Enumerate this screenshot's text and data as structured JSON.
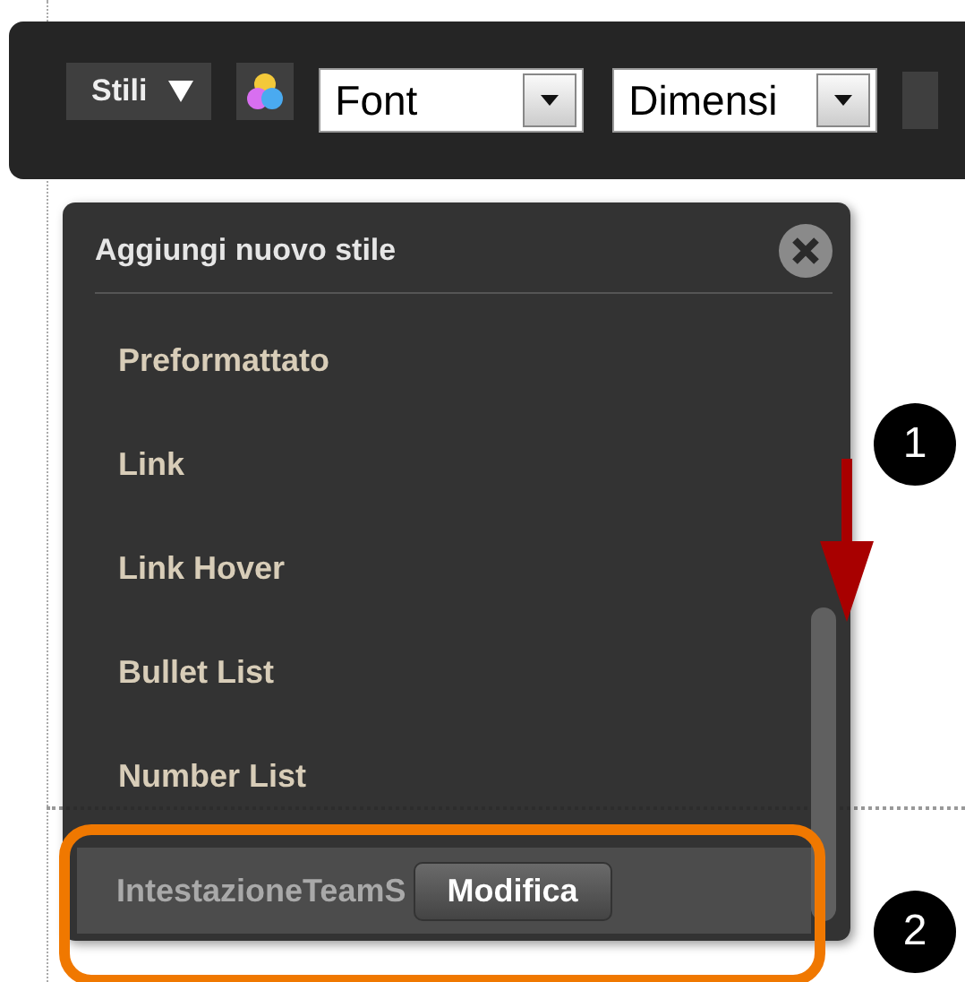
{
  "toolbar": {
    "styles_button": "Stili",
    "font_select": {
      "value": "Font"
    },
    "size_select": {
      "value": "Dimensi"
    }
  },
  "styles_popup": {
    "title": "Aggiungi nuovo stile",
    "items": [
      {
        "label": "Preformattato",
        "selected": false
      },
      {
        "label": "Link",
        "selected": false
      },
      {
        "label": "Link Hover",
        "selected": false
      },
      {
        "label": "Bullet List",
        "selected": false
      },
      {
        "label": "Number List",
        "selected": false
      },
      {
        "label": "IntestazioneTeamS",
        "selected": true,
        "edit_button": "Modifica"
      }
    ]
  },
  "callouts": [
    "1",
    "2"
  ]
}
